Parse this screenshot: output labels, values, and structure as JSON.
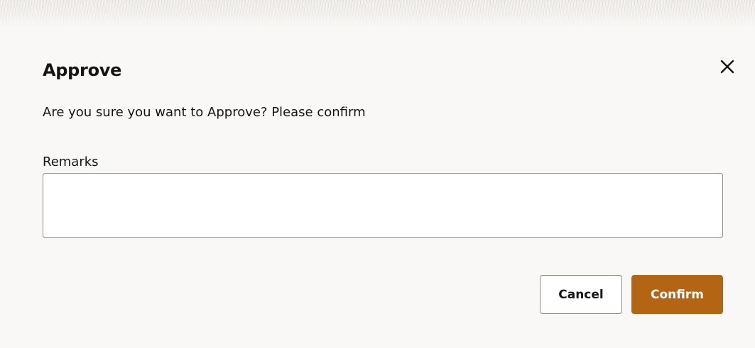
{
  "dialog": {
    "title": "Approve",
    "message": "Are you sure you want to Approve? Please confirm",
    "close_icon": "close-icon",
    "remarks": {
      "label": "Remarks",
      "value": "",
      "placeholder": ""
    },
    "buttons": {
      "cancel_label": "Cancel",
      "confirm_label": "Confirm"
    }
  },
  "colors": {
    "background": "#f9f8f6",
    "text": "#161513",
    "border": "#8f8b86",
    "confirm_button": "#b46514",
    "confirm_text": "#ffffff"
  }
}
